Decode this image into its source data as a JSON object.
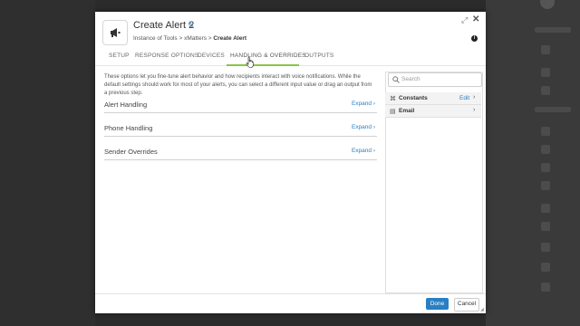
{
  "dialog": {
    "title": "Create Alert 2",
    "breadcrumb": {
      "path": "Instance of Tools > xMatters > ",
      "current": "Create Alert"
    },
    "header_icon": "megaphone-icon"
  },
  "tabs": [
    {
      "label": "SETUP",
      "active": false
    },
    {
      "label": "RESPONSE OPTIONS",
      "active": false
    },
    {
      "label": "DEVICES",
      "active": false
    },
    {
      "label": "HANDLING & OVERRIDES",
      "active": true
    },
    {
      "label": "OUTPUTS",
      "active": false
    }
  ],
  "main": {
    "description": "These options let you fine-tune alert behavior and how recipients interact with voice notifications. While the default settings should work for most of your alerts, you can select a different input value or drag an output from a previous step.",
    "sections": [
      {
        "label": "Alert Handling",
        "action": "Expand"
      },
      {
        "label": "Phone Handling",
        "action": "Expand"
      },
      {
        "label": "Sender Overrides",
        "action": "Expand"
      }
    ]
  },
  "panel": {
    "search_placeholder": "Search",
    "items": [
      {
        "label": "Constants",
        "action": "Edit",
        "icon": "constants-icon"
      },
      {
        "label": "Email",
        "action": "",
        "icon": "email-icon"
      }
    ]
  },
  "footer": {
    "done_label": "Done",
    "cancel_label": "Cancel"
  },
  "colors": {
    "accent": "#2a7fc2",
    "active_tab_underline": "#8bc34a"
  }
}
